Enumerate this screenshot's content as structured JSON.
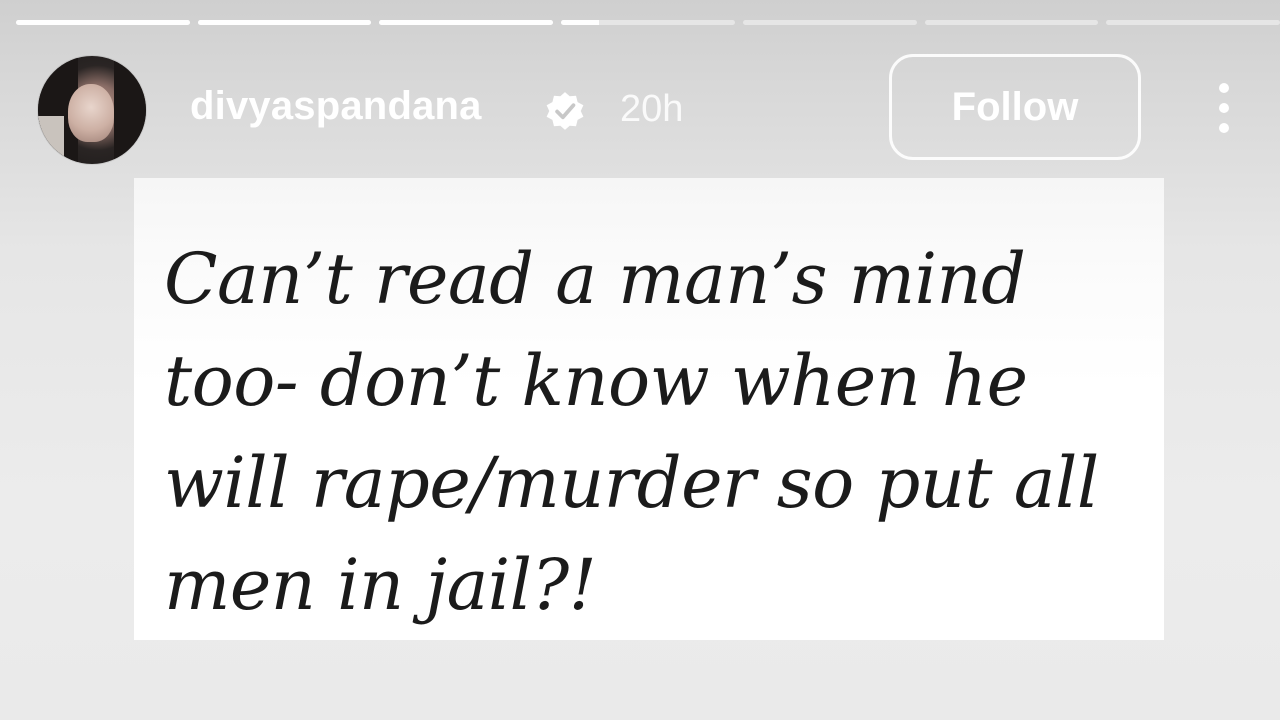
{
  "story": {
    "segments_total": 7,
    "current_segment_index": 3,
    "current_segment_progress": 0.22
  },
  "header": {
    "username": "divyaspandana",
    "verified": true,
    "timestamp": "20h",
    "follow_label": "Follow"
  },
  "icons": {
    "verified": "verified-badge-icon",
    "more": "more-options-icon"
  },
  "post": {
    "text": "Can’t read a man’s mind too- don’t know when he will rape/murder so put all men in jail?!"
  },
  "colors": {
    "text_on_story": "#ffffff",
    "quote_text": "#1b1b1b",
    "card_background": "#ffffff"
  }
}
